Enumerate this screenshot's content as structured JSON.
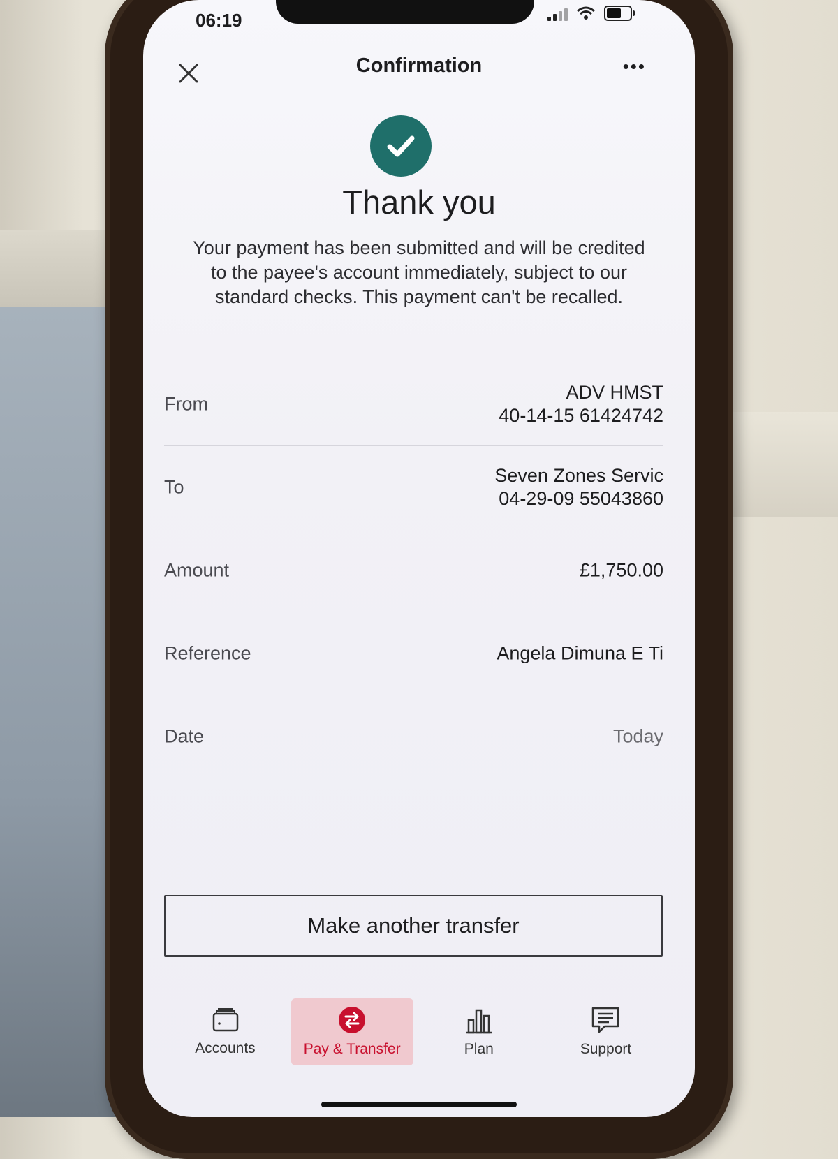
{
  "status_bar": {
    "time": "06:19"
  },
  "header": {
    "title": "Confirmation",
    "more_label": "•••"
  },
  "confirmation": {
    "title": "Thank you",
    "message": "Your payment has been submitted and will be credited to the payee's account immediately, subject to our standard checks. This payment can't be recalled."
  },
  "details": {
    "from": {
      "label": "From",
      "name": "ADV HMST",
      "account": "40-14-15 61424742"
    },
    "to": {
      "label": "To",
      "name": "Seven Zones Servic",
      "account": "04-29-09 55043860"
    },
    "amount": {
      "label": "Amount",
      "value": "£1,750.00"
    },
    "reference": {
      "label": "Reference",
      "value": "Angela Dimuna E Ti"
    },
    "date": {
      "label": "Date",
      "value": "Today"
    }
  },
  "actions": {
    "make_another_transfer": "Make another transfer"
  },
  "tabbar": {
    "tabs": [
      {
        "label": "Accounts",
        "icon": "wallet-icon",
        "active": false
      },
      {
        "label": "Pay & Transfer",
        "icon": "transfer-icon",
        "active": true
      },
      {
        "label": "Plan",
        "icon": "bar-chart-icon",
        "active": false
      },
      {
        "label": "Support",
        "icon": "chat-icon",
        "active": false
      }
    ]
  },
  "colors": {
    "success": "#1f6f6a",
    "brand_red": "#c8102e",
    "active_tab_bg": "#f0c9cf"
  }
}
